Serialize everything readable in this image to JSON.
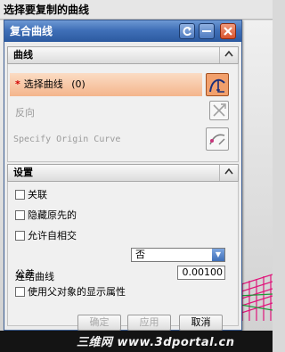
{
  "prompt": {
    "text": "选择要复制的曲线"
  },
  "dialog": {
    "title": "复合曲线",
    "window_buttons": {
      "reset_icon": "reset-icon",
      "minimize_icon": "minus-icon",
      "close_icon": "close-icon"
    },
    "sections": {
      "curve": {
        "title": "曲线",
        "select_curve": {
          "required_mark": "*",
          "label": "选择曲线",
          "count": "(0)",
          "icon": "curve-select-icon"
        },
        "reverse": {
          "label": "反向",
          "icon": "reverse-direction-icon"
        },
        "origin": {
          "label": "Specify Origin Curve",
          "icon": "origin-curve-icon"
        }
      },
      "settings": {
        "title": "设置",
        "checkboxes": [
          {
            "label": "关联",
            "checked": false
          },
          {
            "label": "隐藏原先的",
            "checked": false
          },
          {
            "label": "允许自相交",
            "checked": false
          }
        ],
        "join_curve": {
          "label": "连结曲线",
          "value": "否"
        },
        "tolerance": {
          "label": "公差",
          "value": "0.00100"
        },
        "use_parent_display": {
          "label": "使用父对象的显示属性",
          "checked": false
        }
      }
    },
    "buttons": {
      "ok": "确定",
      "apply": "应用",
      "cancel": "取消"
    }
  },
  "watermark": {
    "text": "三维网 www.3dportal.cn"
  }
}
